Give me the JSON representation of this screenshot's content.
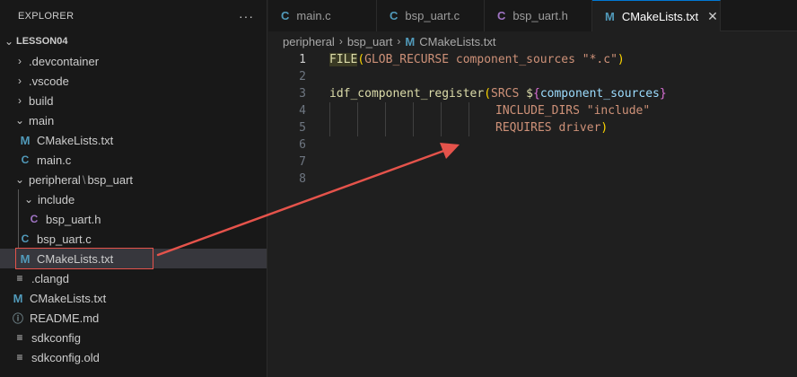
{
  "sidebar": {
    "title": "EXPLORER",
    "more": "···",
    "root": "LESSON04",
    "items": [
      {
        "label": ".devcontainer",
        "kind": "folder",
        "open": false
      },
      {
        "label": ".vscode",
        "kind": "folder",
        "open": false
      },
      {
        "label": "build",
        "kind": "folder",
        "open": false
      },
      {
        "label": "main",
        "kind": "folder",
        "open": true
      },
      {
        "label": "CMakeLists.txt",
        "kind": "cmake"
      },
      {
        "label": "main.c",
        "kind": "c"
      },
      {
        "label": "peripheral",
        "sep": "\\",
        "label2": "bsp_uart",
        "kind": "folder",
        "open": true
      },
      {
        "label": "include",
        "kind": "folder",
        "open": true
      },
      {
        "label": "bsp_uart.h",
        "kind": "h"
      },
      {
        "label": "bsp_uart.c",
        "kind": "c"
      },
      {
        "label": "CMakeLists.txt",
        "kind": "cmake",
        "selected": true
      },
      {
        "label": ".clangd",
        "kind": "lines"
      },
      {
        "label": "CMakeLists.txt",
        "kind": "cmake"
      },
      {
        "label": "README.md",
        "kind": "info"
      },
      {
        "label": "sdkconfig",
        "kind": "lines"
      },
      {
        "label": "sdkconfig.old",
        "kind": "lines"
      }
    ]
  },
  "tabs": [
    {
      "label": "main.c",
      "icon": "C",
      "active": false
    },
    {
      "label": "bsp_uart.c",
      "icon": "C",
      "active": false
    },
    {
      "label": "bsp_uart.h",
      "icon": "C",
      "active": false
    },
    {
      "label": "CMakeLists.txt",
      "icon": "M",
      "active": true
    }
  ],
  "tab_close": "✕",
  "breadcrumb": {
    "a": "peripheral",
    "b": "bsp_uart",
    "c": "CMakeLists.txt",
    "sep": "›"
  },
  "editor": {
    "line_numbers": [
      "1",
      "2",
      "3",
      "4",
      "5",
      "6",
      "7",
      "8"
    ],
    "line1": {
      "fn": "FILE",
      "open": "(",
      "body": "GLOB_RECURSE component_sources ",
      "str": "\"*.c\"",
      "close": ")"
    },
    "line3": {
      "fn": "idf_component_register",
      "open": "(",
      "kw": "SRCS ",
      "dollar": "$",
      "brace_open": "{",
      "var": "component_sources",
      "brace_close": "}"
    },
    "line4": {
      "text": "INCLUDE_DIRS \"include\""
    },
    "line5": {
      "text": "REQUIRES driver",
      "close": ")"
    }
  },
  "colors": {
    "accent": "#0078d4",
    "annotation": "#e5534b",
    "c_icon": "#519aba",
    "h_icon": "#a074c4"
  }
}
